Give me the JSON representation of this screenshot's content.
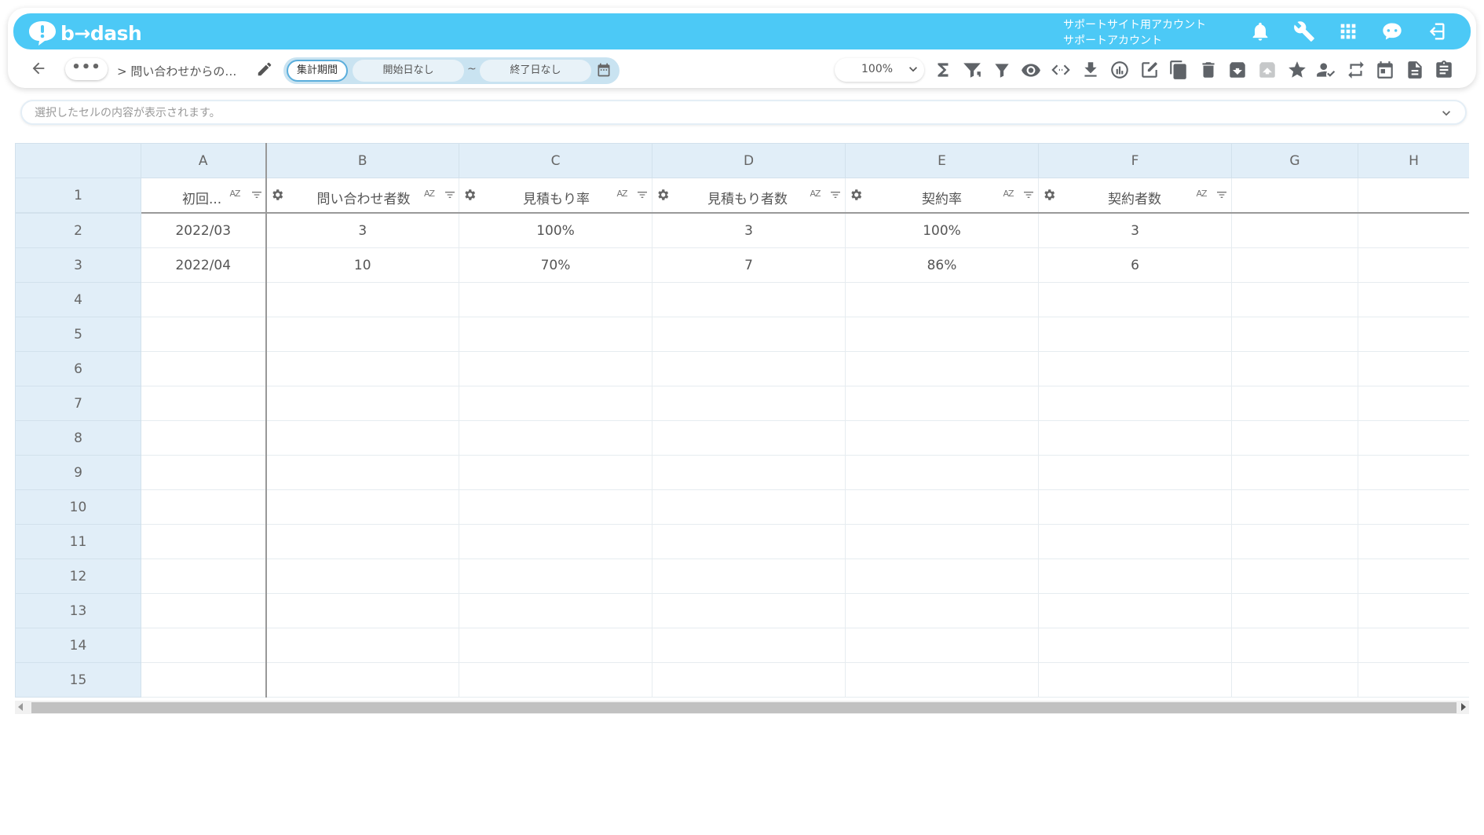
{
  "brand": {
    "logo_text": "b→dash",
    "color": "#4cc9f6"
  },
  "account": {
    "line1": "サポートサイト用アカウント",
    "line2": "サポートアカウント"
  },
  "top_icons": [
    "bell-icon",
    "wrench-icon",
    "apps-grid-icon",
    "chat-bot-icon",
    "logout-icon"
  ],
  "toolbar": {
    "more_label": "•••",
    "breadcrumb": "> 問い合わせからの…",
    "period_label": "集計期間",
    "start_date": "開始日なし",
    "tilde": "~",
    "end_date": "終了日なし",
    "zoom": "100%",
    "tool_icons": [
      "sum-icon",
      "filter-settings-icon",
      "filter-icon",
      "eye-icon",
      "code-icon",
      "download-icon",
      "chart-icon",
      "edit-note-icon",
      "copy-icon",
      "delete-icon",
      "archive-icon",
      "unarchive-icon",
      "star-icon",
      "user-check-icon",
      "repeat-icon",
      "calendar-icon",
      "document-icon",
      "clipboard-icon"
    ]
  },
  "formula_bar": {
    "placeholder": "選択したセルの内容が表示されます。"
  },
  "sheet": {
    "columns": [
      "A",
      "B",
      "C",
      "D",
      "E",
      "F",
      "G",
      "H"
    ],
    "fields": [
      "初回...",
      "問い合わせ者数",
      "見積もり率",
      "見積もり者数",
      "契約率",
      "契約者数"
    ],
    "sort_label": "AZ",
    "rows": [
      [
        "2022/03",
        "3",
        "100%",
        "3",
        "100%",
        "3"
      ],
      [
        "2022/04",
        "10",
        "70%",
        "7",
        "86%",
        "6"
      ]
    ],
    "row_numbers": [
      "1",
      "2",
      "3",
      "4",
      "5",
      "6",
      "7",
      "8",
      "9",
      "10",
      "11",
      "12",
      "13",
      "14",
      "15"
    ]
  }
}
